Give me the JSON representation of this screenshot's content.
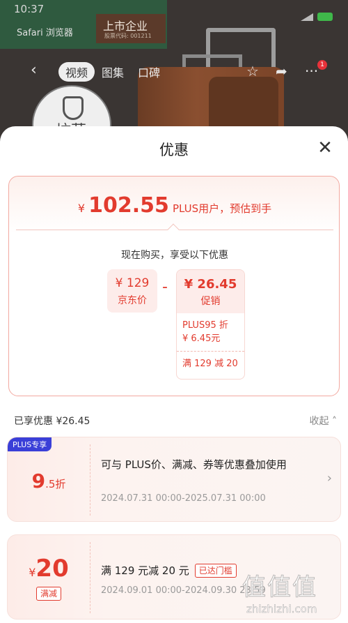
{
  "background": {
    "status_left": "10:37",
    "back_label": "Safari 浏览器",
    "banner_title": "上市企业",
    "banner_sub": "股票代码: 001211",
    "tabs": [
      "视频",
      "图集",
      "口碑"
    ],
    "active_tab": "视频",
    "share_badge": "1",
    "seal_text": "坑菌"
  },
  "sheet": {
    "title": "优惠",
    "close_label": "✕"
  },
  "summary": {
    "currency": "¥",
    "final_price": "102.55",
    "price_note": "PLUS用户，预估到手",
    "now_text": "现在购买，享受以下优惠",
    "jd_price_value": "¥ 129",
    "jd_price_label": "京东价",
    "minus": "-",
    "promo_value": "¥ 26.45",
    "promo_label": "促销",
    "promo_items": [
      {
        "line1": "PLUS95 折",
        "line2": "¥ 6.45元"
      },
      {
        "line1": "满 129 减 20",
        "line2": ""
      }
    ]
  },
  "enjoyed": {
    "label": "已享优惠 ¥26.45",
    "collapse": "收起"
  },
  "coupons": [
    {
      "tag": "PLUS专享",
      "discount_big": "9",
      "discount_small": ".5折",
      "desc": "可与 PLUS价、满减、券等优惠叠加使用",
      "date": "2024.07.31 00:00-2025.07.31 00:00"
    },
    {
      "amount_yen": "¥",
      "amount": "20",
      "type": "满减",
      "desc": "满 129 元减 20 元",
      "status": "已达门槛",
      "date": "2024.09.01 00:00-2024.09.30 23:59"
    }
  ],
  "watermark": {
    "glyphs": "值值值",
    "url": "zhizhizhi.com"
  },
  "colors": {
    "accent": "#e23b2e",
    "plus_tag": "#3a3fd8"
  }
}
